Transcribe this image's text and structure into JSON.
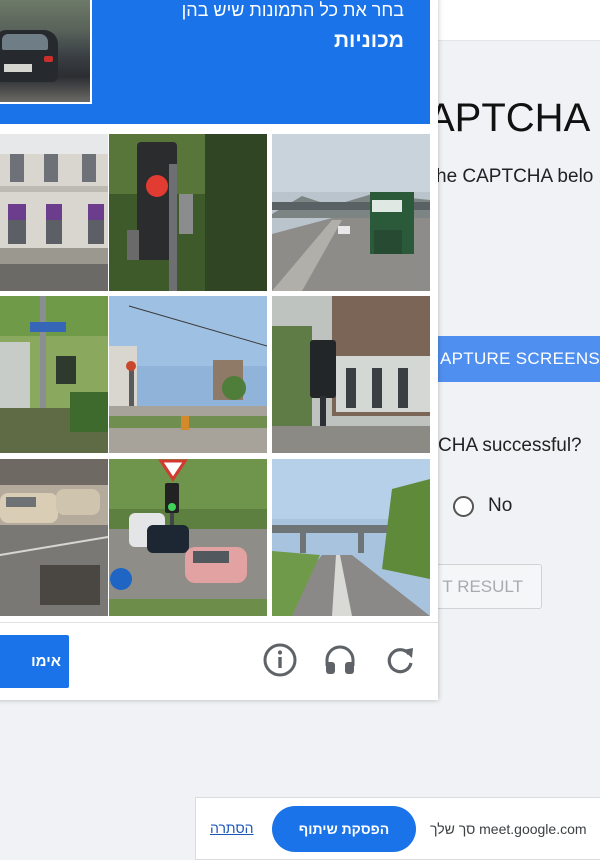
{
  "page": {
    "title_partial": "APTCHA",
    "instruction_partial": "he CAPTCHA belo",
    "capture_button": "APTURE SCREENS",
    "question_partial": "CHA successful?",
    "no_label": "No",
    "result_button_partial": "T RESULT"
  },
  "captcha": {
    "header_line1": "בחר את כל התמונות שיש בהן",
    "header_line2": "מכוניות",
    "sample_image": "car-image",
    "tiles": [
      {
        "name": "building-facade"
      },
      {
        "name": "traffic-light-closeup"
      },
      {
        "name": "truck-on-highway"
      },
      {
        "name": "street-sign-trees"
      },
      {
        "name": "street-lamp-plaza"
      },
      {
        "name": "traffic-light-buildings"
      },
      {
        "name": "parked-cars"
      },
      {
        "name": "street-cars-yield-sign"
      },
      {
        "name": "road-overpass"
      }
    ],
    "verify_button": "אימו",
    "icons": [
      "info-icon",
      "headphones-icon",
      "reload-icon"
    ]
  },
  "sharebar": {
    "text": "meet.google.com משתף את המסך שלך",
    "text_visible": "meet.google.com סך שלך",
    "stop_button": "הפסקת שיתוף",
    "hide_link": "הסתרה"
  },
  "colors": {
    "accent": "#1a73e8",
    "capture_button": "#4f8fef"
  }
}
